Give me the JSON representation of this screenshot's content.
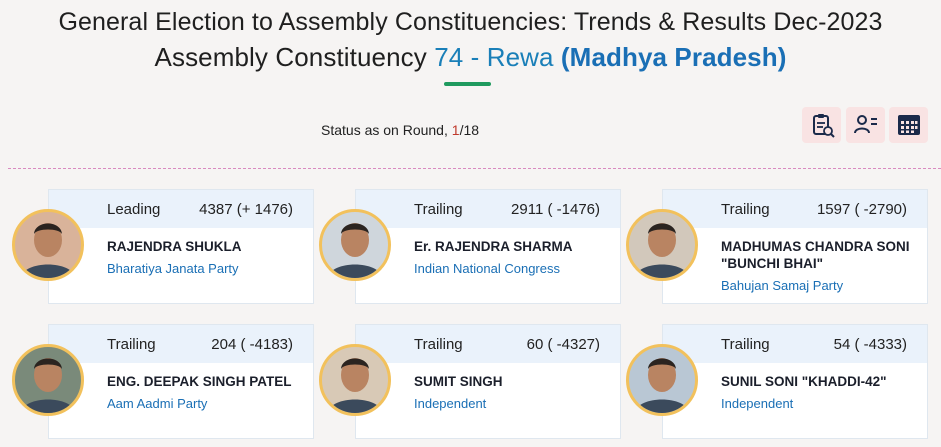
{
  "header": {
    "title_line1": "General Election to Assembly Constituencies: Trends & Results Dec-2023",
    "title_prefix": "Assembly Constituency",
    "constituency_number": "74",
    "constituency_sep": " - ",
    "constituency_name": "Rewa",
    "state": "(Madhya Pradesh)"
  },
  "status": {
    "label": "Status as on Round,",
    "current_round": "1",
    "total_rounds": "/18"
  },
  "toolbar": {
    "icons": [
      "clipboard-list-icon",
      "user-list-icon",
      "calendar-grid-icon"
    ]
  },
  "colors": {
    "accent": "#1a6fb5",
    "underline": "#1f9a5e",
    "photo_ring": "#f2c15c",
    "round": "#c0392b"
  },
  "candidates": [
    {
      "status": "Leading",
      "votes": "4387 (+ 1476)",
      "name": "RAJENDRA SHUKLA",
      "party": "Bharatiya Janata Party"
    },
    {
      "status": "Trailing",
      "votes": "2911 ( -1476)",
      "name": "Er. RAJENDRA SHARMA",
      "party": "Indian National Congress"
    },
    {
      "status": "Trailing",
      "votes": "1597 ( -2790)",
      "name": "MADHUMAS CHANDRA SONI \"BUNCHI BHAI\"",
      "party": "Bahujan Samaj Party"
    },
    {
      "status": "Trailing",
      "votes": "204 ( -4183)",
      "name": "ENG. DEEPAK SINGH PATEL",
      "party": "Aam Aadmi Party"
    },
    {
      "status": "Trailing",
      "votes": "60 ( -4327)",
      "name": "SUMIT SINGH",
      "party": "Independent"
    },
    {
      "status": "Trailing",
      "votes": "54 ( -4333)",
      "name": "SUNIL SONI \"KHADDI-42\"",
      "party": "Independent"
    }
  ]
}
